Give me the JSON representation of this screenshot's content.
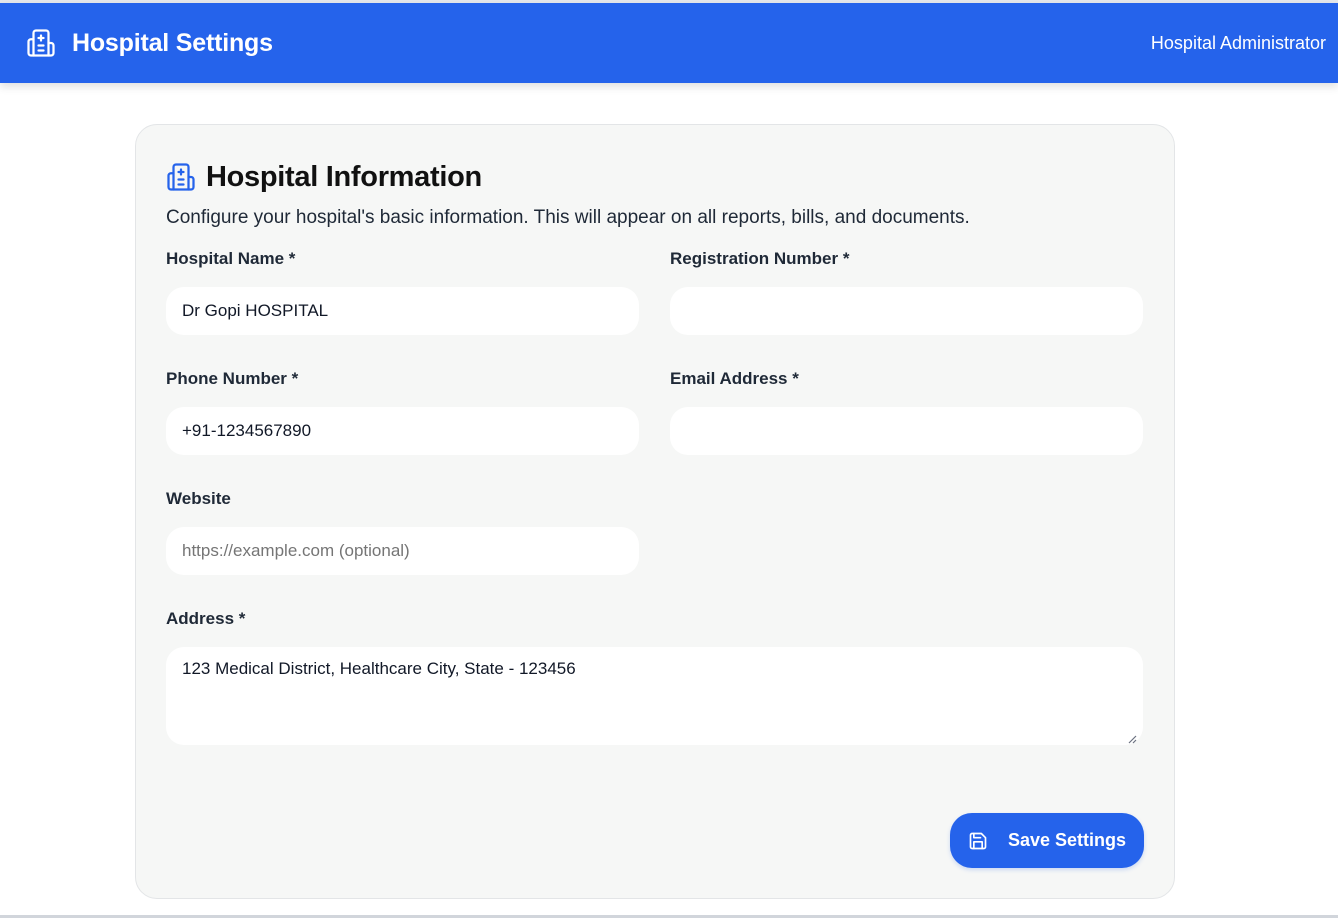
{
  "header": {
    "title": "Hospital Settings",
    "icon": "hospital-icon",
    "user_role": "Hospital Administrator",
    "background_color": "#2563eb"
  },
  "card": {
    "title": "Hospital Information",
    "icon": "hospital-icon",
    "description": "Configure your hospital's basic information. This will appear on all reports, bills, and documents."
  },
  "form": {
    "hospital_name": {
      "label": "Hospital Name *",
      "value": "Dr Gopi HOSPITAL",
      "placeholder": ""
    },
    "registration_number": {
      "label": "Registration Number *",
      "value": "",
      "placeholder": ""
    },
    "phone_number": {
      "label": "Phone Number *",
      "value": "+91-1234567890",
      "placeholder": ""
    },
    "email_address": {
      "label": "Email Address *",
      "value": "",
      "placeholder": ""
    },
    "website": {
      "label": "Website",
      "value": "",
      "placeholder": "https://example.com (optional)"
    },
    "address": {
      "label": "Address *",
      "value": "123 Medical District, Healthcare City, State - 123456"
    }
  },
  "actions": {
    "save_label": "Save Settings",
    "save_icon": "save-icon",
    "accent_color": "#2563eb"
  }
}
